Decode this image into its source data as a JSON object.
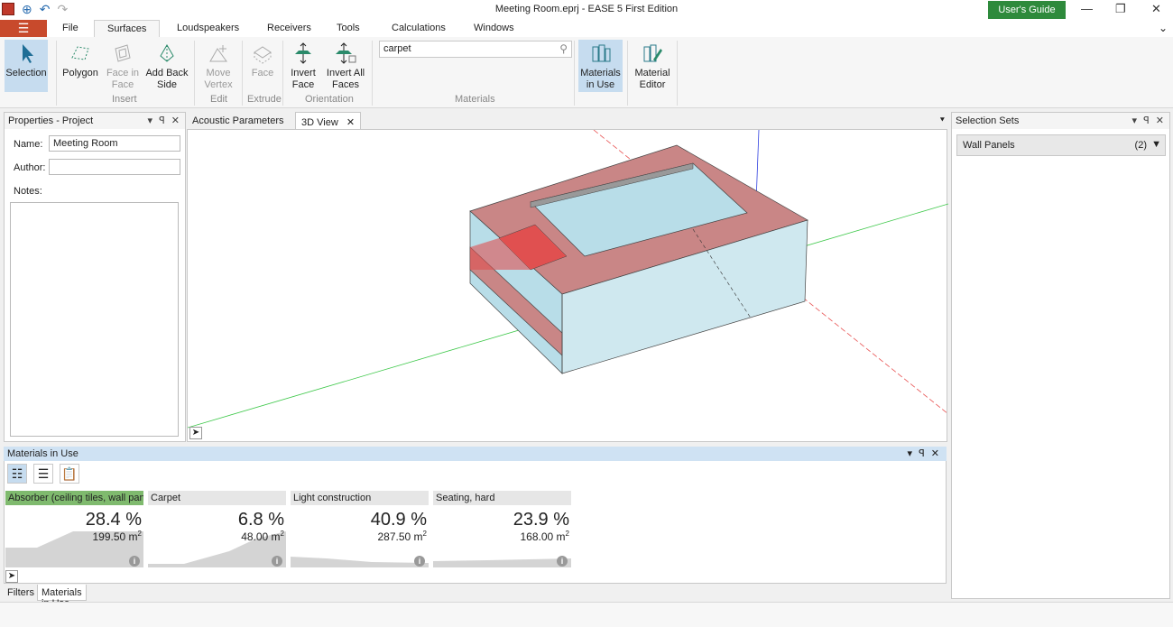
{
  "window": {
    "title": "Meeting Room.eprj - EASE 5 First Edition",
    "users_guide": "User's Guide",
    "minimize": "—",
    "restore": "❐",
    "close": "✕"
  },
  "menu": {
    "burger": "☰",
    "items": [
      "File",
      "Surfaces",
      "Loudspeakers",
      "Receivers",
      "Tools",
      "Calculations",
      "Windows"
    ],
    "active": "Surfaces",
    "chevron": "⌄"
  },
  "ribbon": {
    "buttons": {
      "selection": "Selection",
      "polygon": "Polygon",
      "face_in_face": "Face in Face",
      "add_back_side": "Add Back Side",
      "move_vertex": "Move Vertex",
      "face": "Face",
      "invert_face": "Invert Face",
      "invert_all_faces": "Invert All Faces",
      "materials_in_use": "Materials in Use",
      "material_editor": "Material Editor"
    },
    "groups": {
      "insert": "Insert",
      "edit": "Edit",
      "extrude": "Extrude",
      "orientation": "Orientation",
      "materials": "Materials"
    },
    "search_value": "carpet"
  },
  "properties": {
    "title": "Properties - Project",
    "controls": "▾ ꟼ ✕",
    "name_label": "Name:",
    "name_value": "Meeting Room",
    "author_label": "Author:",
    "author_value": "",
    "notes_label": "Notes:"
  },
  "doc_tabs": {
    "acoustic": "Acoustic Parameters",
    "view3d": "3D View",
    "close": "✕",
    "menu": "⯆"
  },
  "selection_sets": {
    "title": "Selection Sets",
    "controls": "▾ ꟼ ✕",
    "item": "Wall Panels",
    "count": "(2)",
    "arrow": "▼"
  },
  "materials_in_use": {
    "title": "Materials in Use",
    "controls": "▾ ꟼ ✕",
    "cards": [
      {
        "name": "Absorber (ceiling tiles, wall pan...",
        "pct": "28.4 %",
        "area": "199.50 m",
        "active": true
      },
      {
        "name": "Carpet",
        "pct": "6.8 %",
        "area": "48.00 m",
        "active": false
      },
      {
        "name": "Light construction",
        "pct": "40.9 %",
        "area": "287.50 m",
        "active": false
      },
      {
        "name": "Seating, hard",
        "pct": "23.9 %",
        "area": "168.00 m",
        "active": false
      }
    ],
    "area_sup": "2",
    "info": "i"
  },
  "bottom_tabs": {
    "filters": "Filters",
    "materials": "Materials in Use"
  },
  "colors": {
    "accent_red": "#c84a2c",
    "guide_green": "#2e8a3c",
    "active_card": "#7fba6e",
    "selection_blue": "#c6dcef"
  }
}
